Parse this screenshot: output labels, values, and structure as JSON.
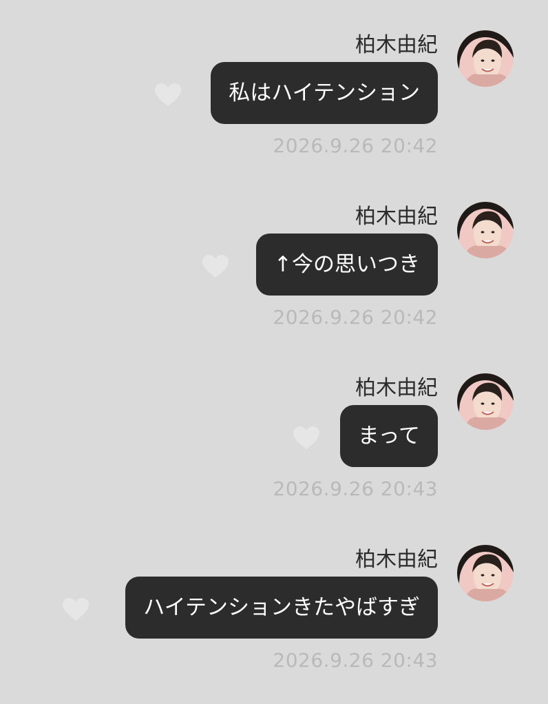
{
  "colors": {
    "background": "#dadada",
    "bubble": "#2c2c2c",
    "bubble_text": "#ffffff",
    "sender_text": "#2b2b2b",
    "timestamp_text": "#b9b9b9",
    "heart": "#e6e6e6"
  },
  "messages": [
    {
      "sender": "柏木由紀",
      "text": "私はハイテンション",
      "time": "2026.9.26 20:42",
      "avatar_icon": "avatar-photo-icon",
      "reaction_icon": "heart-icon"
    },
    {
      "sender": "柏木由紀",
      "text": "↑今の思いつき",
      "time": "2026.9.26 20:42",
      "avatar_icon": "avatar-photo-icon",
      "reaction_icon": "heart-icon"
    },
    {
      "sender": "柏木由紀",
      "text": "まって",
      "time": "2026.9.26 20:43",
      "avatar_icon": "avatar-photo-icon",
      "reaction_icon": "heart-icon"
    },
    {
      "sender": "柏木由紀",
      "text": "ハイテンションきたやばすぎ",
      "time": "2026.9.26 20:43",
      "avatar_icon": "avatar-photo-icon",
      "reaction_icon": "heart-icon"
    }
  ]
}
